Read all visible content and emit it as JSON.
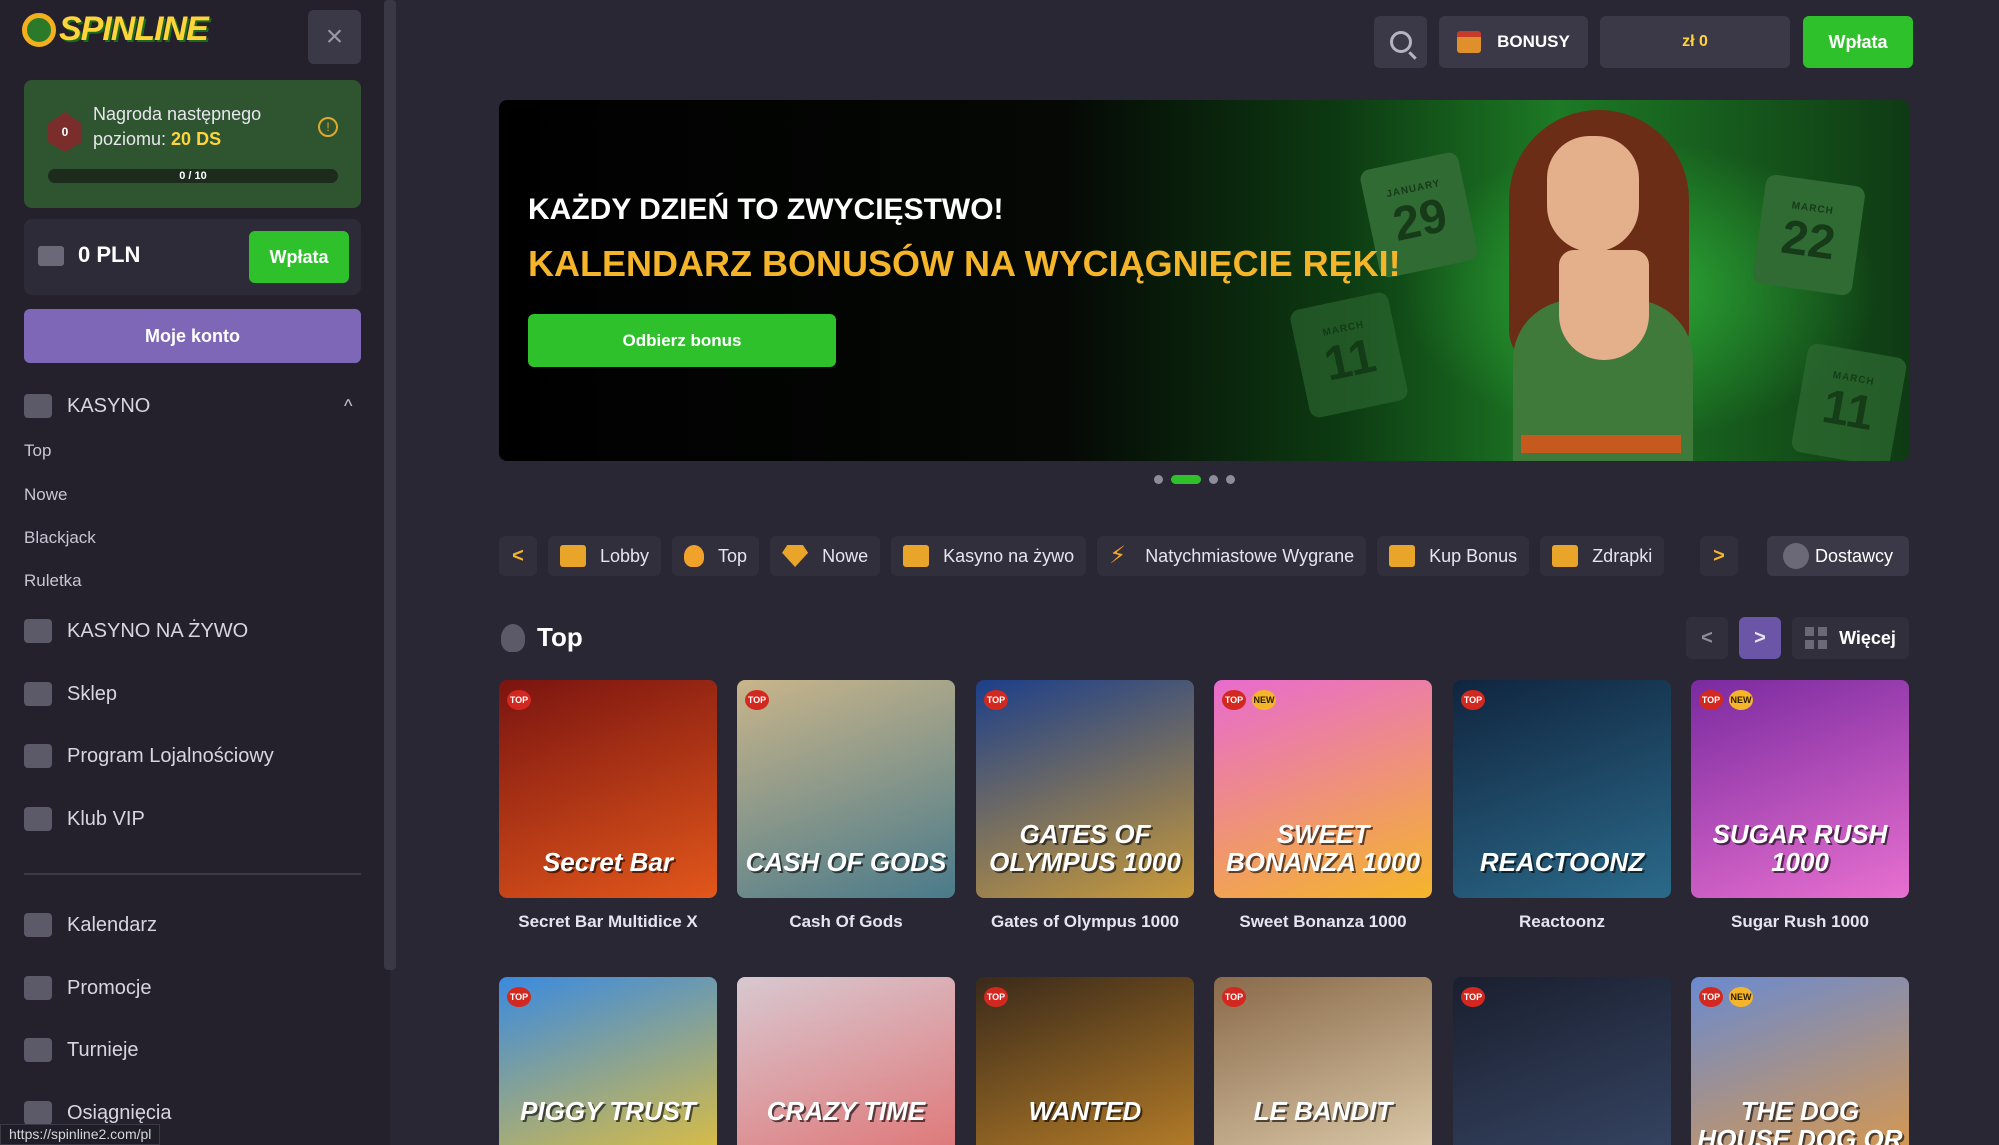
{
  "sidebar": {
    "logo_text": "SPINLINE",
    "close_icon": "×",
    "level": {
      "text_line1": "Nagroda następnego",
      "text_line2_prefix": "poziomu: ",
      "reward": "20 DS",
      "progress_text": "0 / 10",
      "badge_value": "0",
      "info_icon": "!"
    },
    "balance": "0 PLN",
    "deposit_label": "Wpłata",
    "account_label": "Moje konto",
    "casino": {
      "label": "KASYNO",
      "chevron": "^",
      "sub": [
        "Top",
        "Nowe",
        "Blackjack",
        "Ruletka"
      ]
    },
    "items": [
      "KASYNO NA ŻYWO",
      "Sklep",
      "Program Lojalnościowy",
      "Klub VIP"
    ],
    "items2": [
      "Kalendarz",
      "Promocje",
      "Turnieje",
      "Osiągnięcia"
    ]
  },
  "status_url": "https://spinline2.com/pl",
  "header": {
    "bonus_label": "BONUSY",
    "balance": "zł 0",
    "deposit_label": "Wpłata"
  },
  "banner": {
    "line1": "KAŻDY DZIEŃ TO ZWYCIĘSTWO!",
    "line2": "KALENDARZ BONUSÓW NA WYCIĄGNIĘCIE RĘKI!",
    "cta": "Odbierz bonus",
    "calendars": [
      {
        "month": "JANUARY",
        "day": "29"
      },
      {
        "month": "MARCH",
        "day": "22"
      },
      {
        "month": "MARCH",
        "day": "11"
      },
      {
        "month": "MARCH",
        "day": "11"
      }
    ],
    "active_slide": 2,
    "slide_count": 4
  },
  "categories": {
    "prev": "<",
    "next": ">",
    "items": [
      "Lobby",
      "Top",
      "Nowe",
      "Kasyno na żywo",
      "Natychmiastowe Wygrane",
      "Kup Bonus",
      "Zdrapki"
    ],
    "providers_label": "Dostawcy"
  },
  "top_section": {
    "title": "Top",
    "prev": "<",
    "next": ">",
    "more_label": "Więcej",
    "tag_top": "TOP",
    "tag_new": "NEW",
    "games_row1": [
      {
        "name": "Secret Bar Multidice X",
        "art": "Secret Bar",
        "new": false,
        "c1": "#7a1410",
        "c2": "#e2571b"
      },
      {
        "name": "Cash Of Gods",
        "art": "CASH OF GODS",
        "new": false,
        "c1": "#c9b58a",
        "c2": "#4a7a8a"
      },
      {
        "name": "Gates of Olympus 1000",
        "art": "GATES OF OLYMPUS 1000",
        "new": false,
        "c1": "#1c3f8a",
        "c2": "#c99a3a"
      },
      {
        "name": "Sweet Bonanza 1000",
        "art": "SWEET BONANZA 1000",
        "new": true,
        "c1": "#e86bd0",
        "c2": "#f5b52a"
      },
      {
        "name": "Reactoonz",
        "art": "REACTOONZ",
        "new": false,
        "c1": "#10253f",
        "c2": "#2b6a8a"
      },
      {
        "name": "Sugar Rush 1000",
        "art": "SUGAR RUSH 1000",
        "new": true,
        "c1": "#7a2aa0",
        "c2": "#e870d0"
      }
    ],
    "games_row2": [
      {
        "art": "PIGGY TRUST",
        "new": false,
        "top": true,
        "c1": "#3a8ae0",
        "c2": "#f5c52a"
      },
      {
        "art": "CRAZY TIME",
        "new": false,
        "top": false,
        "c1": "#d8c8d0",
        "c2": "#e06a6a"
      },
      {
        "art": "WANTED",
        "new": false,
        "top": true,
        "c1": "#3a2a1a",
        "c2": "#c98a2a"
      },
      {
        "art": "LE BANDIT",
        "new": false,
        "top": true,
        "c1": "#8a6a4a",
        "c2": "#e8d8b8"
      },
      {
        "art": "",
        "new": false,
        "top": true,
        "c1": "#1a1f2f",
        "c2": "#3a4a6a"
      },
      {
        "art": "THE DOG HOUSE DOG OR ALIVE",
        "new": true,
        "top": true,
        "c1": "#6a8ad0",
        "c2": "#e89a3a"
      }
    ]
  },
  "colors": {
    "accent_green": "#2fc12b",
    "accent_purple": "#7f67b8",
    "gold": "#f5b52a",
    "bg": "#2a2734",
    "sidebar_bg": "#24212d"
  }
}
